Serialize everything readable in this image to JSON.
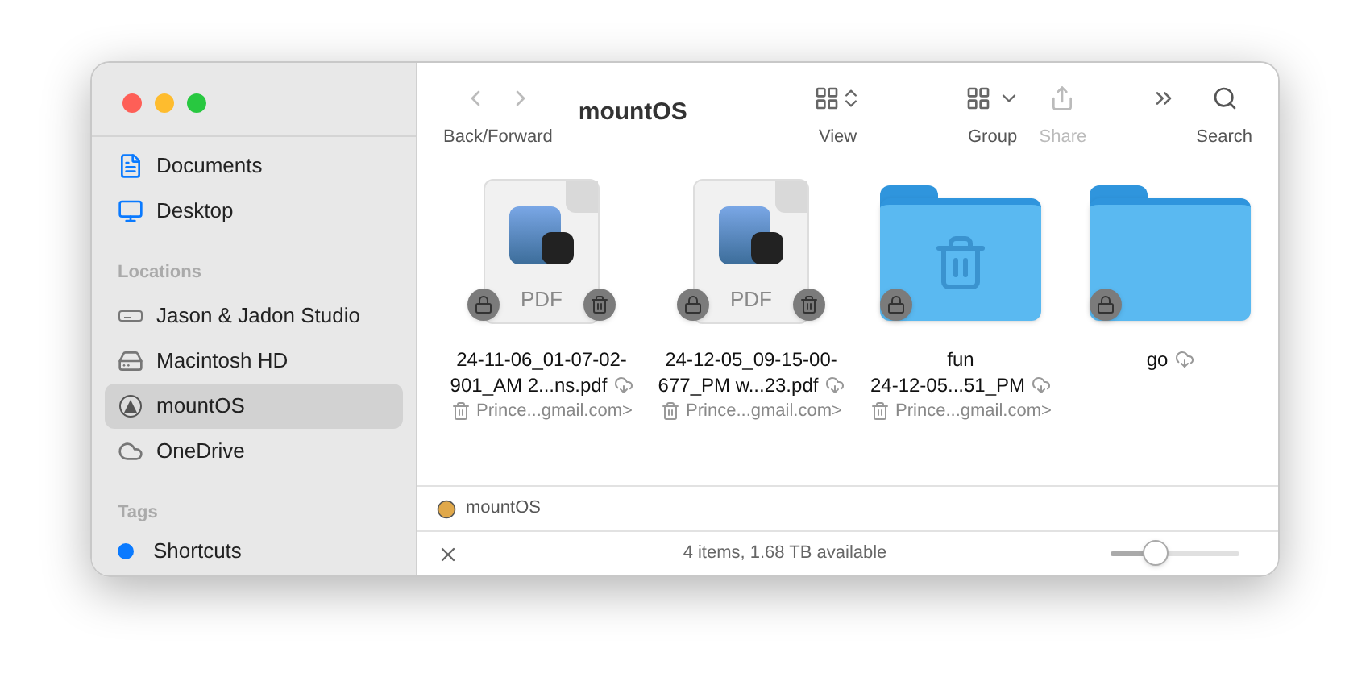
{
  "sidebar": {
    "favorites": [
      {
        "label": "Documents",
        "kind": "document",
        "selected": false
      },
      {
        "label": "Desktop",
        "kind": "desktop",
        "selected": false
      }
    ],
    "locations_heading": "Locations",
    "locations": [
      {
        "label": "Jason & Jadon Studio",
        "kind": "server",
        "selected": false
      },
      {
        "label": "Macintosh HD",
        "kind": "disk",
        "selected": false
      },
      {
        "label": "mountOS",
        "kind": "volume",
        "selected": true
      },
      {
        "label": "OneDrive",
        "kind": "cloud",
        "selected": false
      }
    ],
    "tags_heading": "Tags",
    "tags": [
      {
        "label": "Shortcuts",
        "color": "#0a7aff"
      }
    ]
  },
  "toolbar": {
    "nav_label": "Back/Forward",
    "title": "mountOS",
    "view_label": "View",
    "group_label": "Group",
    "share_label": "Share",
    "search_label": "Search"
  },
  "files": [
    {
      "kind": "pdf",
      "name": [
        "24-11-06_01-07-02-",
        "901_AM 2...ns.pdf"
      ],
      "owner": "Prince...gmail.com>",
      "trash_badge": true,
      "type_label": "PDF"
    },
    {
      "kind": "pdf",
      "name": [
        "24-12-05_09-15-00-",
        "677_PM w...23.pdf"
      ],
      "owner": "Prince...gmail.com>",
      "trash_badge": true,
      "type_label": "PDF"
    },
    {
      "kind": "trash_folder",
      "name": [
        "fun",
        "24-12-05...51_PM"
      ],
      "owner": "Prince...gmail.com>",
      "trash_badge": false
    },
    {
      "kind": "folder",
      "name": [
        "go"
      ],
      "trash_badge": false
    }
  ],
  "path_bar": {
    "label": "mountOS"
  },
  "status_bar": {
    "text": "4 items, 1.68 TB available",
    "zoom": {
      "level": 0.35
    }
  }
}
